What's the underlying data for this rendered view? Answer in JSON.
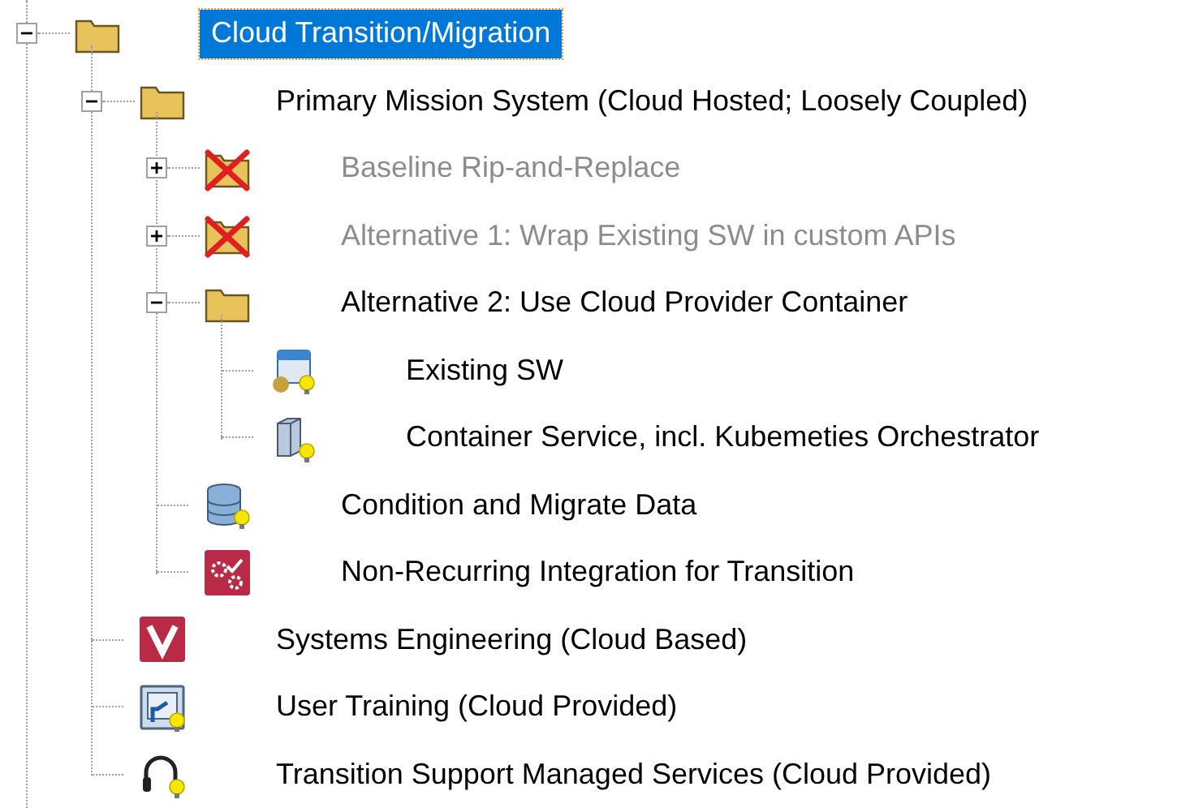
{
  "tree": [
    {
      "label": "Cloud Transition/Migration",
      "kind": "folder",
      "expanded": true,
      "selected": true,
      "disabled": false,
      "children": [
        {
          "label": "Primary Mission System (Cloud Hosted; Loosely Coupled)",
          "kind": "folder",
          "expanded": true,
          "selected": false,
          "disabled": false,
          "children": [
            {
              "label": "Baseline Rip-and-Replace",
              "kind": "crossed",
              "expanded": false,
              "selected": false,
              "disabled": true
            },
            {
              "label": "Alternative 1: Wrap Existing SW in custom APIs",
              "kind": "crossed",
              "expanded": false,
              "selected": false,
              "disabled": true
            },
            {
              "label": "Alternative 2: Use Cloud Provider Container",
              "kind": "folder",
              "expanded": true,
              "selected": false,
              "disabled": false,
              "children": [
                {
                  "label": "Existing SW",
                  "kind": "app",
                  "selected": false,
                  "disabled": false
                },
                {
                  "label": "Container Service, incl. Kubemeties Orchestrator",
                  "kind": "server",
                  "selected": false,
                  "disabled": false
                }
              ]
            },
            {
              "label": "Condition and Migrate Data",
              "kind": "database",
              "selected": false,
              "disabled": false
            },
            {
              "label": "Non-Recurring Integration for Transition",
              "kind": "gears",
              "selected": false,
              "disabled": false
            }
          ]
        },
        {
          "label": "Systems Engineering (Cloud Based)",
          "kind": "logo",
          "selected": false,
          "disabled": false
        },
        {
          "label": "User Training (Cloud Provided)",
          "kind": "board",
          "selected": false,
          "disabled": false
        },
        {
          "label": "Transition Support Managed Services (Cloud Provided)",
          "kind": "headset",
          "selected": false,
          "disabled": false
        }
      ]
    }
  ]
}
